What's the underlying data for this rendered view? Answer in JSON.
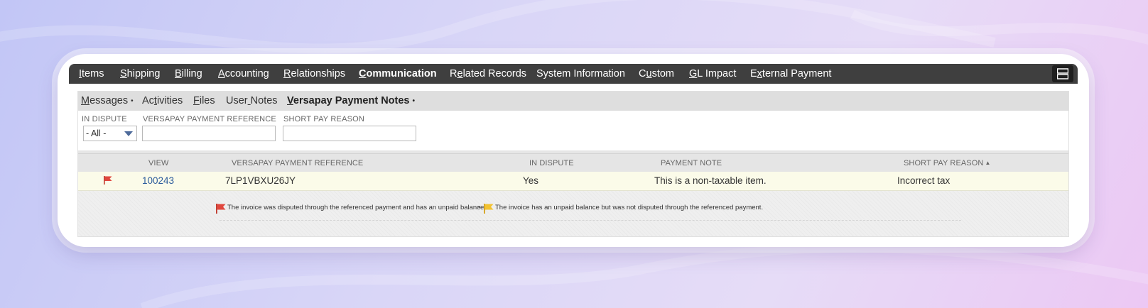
{
  "main_tabs": [
    {
      "pre": "",
      "acc": "I",
      "post": "tems"
    },
    {
      "pre": "",
      "acc": "S",
      "post": "hipping"
    },
    {
      "pre": "",
      "acc": "B",
      "post": "illing"
    },
    {
      "pre": "",
      "acc": "A",
      "post": "ccounting"
    },
    {
      "pre": "",
      "acc": "R",
      "post": "elationships"
    },
    {
      "pre": "",
      "acc": "C",
      "post": "ommunication"
    },
    {
      "pre": "R",
      "acc": "e",
      "post": "lated Records"
    },
    {
      "pre": "System Information",
      "acc": "",
      "post": ""
    },
    {
      "pre": "C",
      "acc": "u",
      "post": "stom"
    },
    {
      "pre": "",
      "acc": "G",
      "post": "L Impact"
    },
    {
      "pre": "E",
      "acc": "x",
      "post": "ternal Payment"
    }
  ],
  "sub_tabs": [
    {
      "pre": "",
      "acc": "M",
      "post": "essages",
      "dot": "•"
    },
    {
      "pre": "Ac",
      "acc": "t",
      "post": "ivities",
      "dot": ""
    },
    {
      "pre": "",
      "acc": "F",
      "post": "iles",
      "dot": ""
    },
    {
      "pre": "User",
      "acc": " ",
      "post": "Notes",
      "dot": ""
    },
    {
      "pre": "",
      "acc": "V",
      "post": "ersapay Payment Notes",
      "dot": "•"
    }
  ],
  "filters": {
    "in_dispute": {
      "label": "IN DISPUTE",
      "value": "- All -"
    },
    "payment_reference": {
      "label": "VERSAPAY PAYMENT REFERENCE",
      "value": ""
    },
    "short_pay_reason": {
      "label": "SHORT PAY REASON",
      "value": ""
    }
  },
  "table": {
    "headers": {
      "view": "VIEW",
      "reference": "VERSAPAY PAYMENT REFERENCE",
      "in_dispute": "IN DISPUTE",
      "payment_note": "PAYMENT NOTE",
      "short_pay_reason": "SHORT PAY REASON",
      "sort_indicator": "▲"
    },
    "rows": [
      {
        "flag": "red-flag",
        "view": "100243",
        "reference": "7LP1VBXU26JY",
        "in_dispute": "Yes",
        "payment_note": "This is a non-taxable item.",
        "short_pay_reason": "Incorrect tax"
      }
    ]
  },
  "legend": {
    "red": "The invoice was disputed through the referenced payment and has an unpaid balance.",
    "separator": "•",
    "yellow": "The invoice has an unpaid balance but was not disputed through the referenced payment."
  },
  "colors": {
    "tab_bar": "#3f3f3f",
    "red_flag": "#e0473e",
    "yellow_flag": "#f2c231",
    "link": "#2a5a9b",
    "row_highlight": "#fbfbe9"
  }
}
